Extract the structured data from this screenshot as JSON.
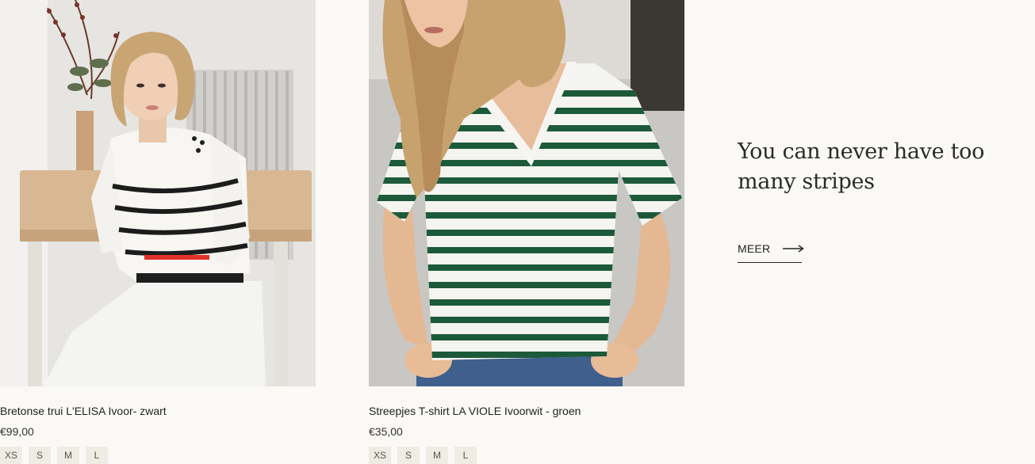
{
  "products": [
    {
      "title": "Bretonse trui L'ELISA Ivoor- zwart",
      "price": "€99,00",
      "sizes": [
        "XS",
        "S",
        "M",
        "L"
      ],
      "image": "woman-in-white-black-striped-sweater-sitting-at-table"
    },
    {
      "title": "Streepjes T-shirt LA VIOLE Ivoorwit - groen",
      "price": "€35,00",
      "sizes": [
        "XS",
        "S",
        "M",
        "L"
      ],
      "image": "woman-in-green-white-striped-vneck-tshirt"
    }
  ],
  "promo": {
    "heading": "You can never have too many stripes",
    "link_label": "MEER",
    "link_icon": "arrow-right-icon"
  },
  "colors": {
    "background": "#faf9f6",
    "size_chip_bg": "#efece4",
    "text": "#222222"
  }
}
